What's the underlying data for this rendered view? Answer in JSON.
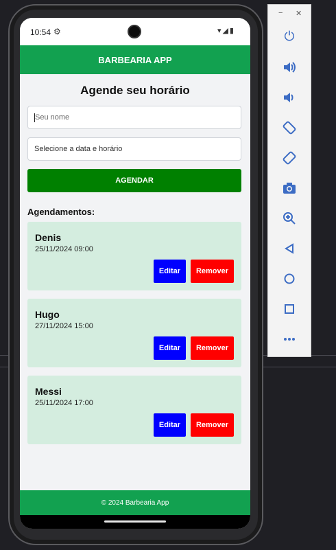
{
  "status": {
    "time": "10:54",
    "gear_icon": "gear-icon",
    "icons": "▾◢▮"
  },
  "app": {
    "title": "BARBEARIA APP"
  },
  "form": {
    "heading": "Agende seu horário",
    "name_placeholder": "Seu nome",
    "datetime_placeholder": "Selecione a data e horário",
    "submit_label": "AGENDAR"
  },
  "list": {
    "label": "Agendamentos:",
    "items": [
      {
        "name": "Denis",
        "datetime": "25/11/2024 09:00",
        "edit": "Editar",
        "remove": "Remover"
      },
      {
        "name": "Hugo",
        "datetime": "27/11/2024 15:00",
        "edit": "Editar",
        "remove": "Remover"
      },
      {
        "name": "Messi",
        "datetime": "25/11/2024 17:00",
        "edit": "Editar",
        "remove": "Remover"
      }
    ]
  },
  "footer": {
    "text": "© 2024 Barbearia App"
  },
  "colors": {
    "primary": "#12a150",
    "submit": "#008000",
    "edit": "#0000ff",
    "remove": "#ff0000",
    "card": "#d4eddf"
  },
  "toolbar": {
    "minimize": "−",
    "close": "✕",
    "buttons": [
      {
        "icon": "power-icon",
        "glyph": "⏻"
      },
      {
        "icon": "volume-up-icon",
        "glyph": "🔊"
      },
      {
        "icon": "volume-down-icon",
        "glyph": "🔉"
      },
      {
        "icon": "rotate-left-icon",
        "glyph": "⟲"
      },
      {
        "icon": "rotate-right-icon",
        "glyph": "⟳"
      },
      {
        "icon": "camera-icon",
        "glyph": "📷"
      },
      {
        "icon": "zoom-icon",
        "glyph": "🔍"
      },
      {
        "icon": "back-icon",
        "glyph": "◁"
      },
      {
        "icon": "home-icon",
        "glyph": "○"
      },
      {
        "icon": "overview-icon",
        "glyph": "□"
      },
      {
        "icon": "more-icon",
        "glyph": "•••"
      }
    ]
  }
}
